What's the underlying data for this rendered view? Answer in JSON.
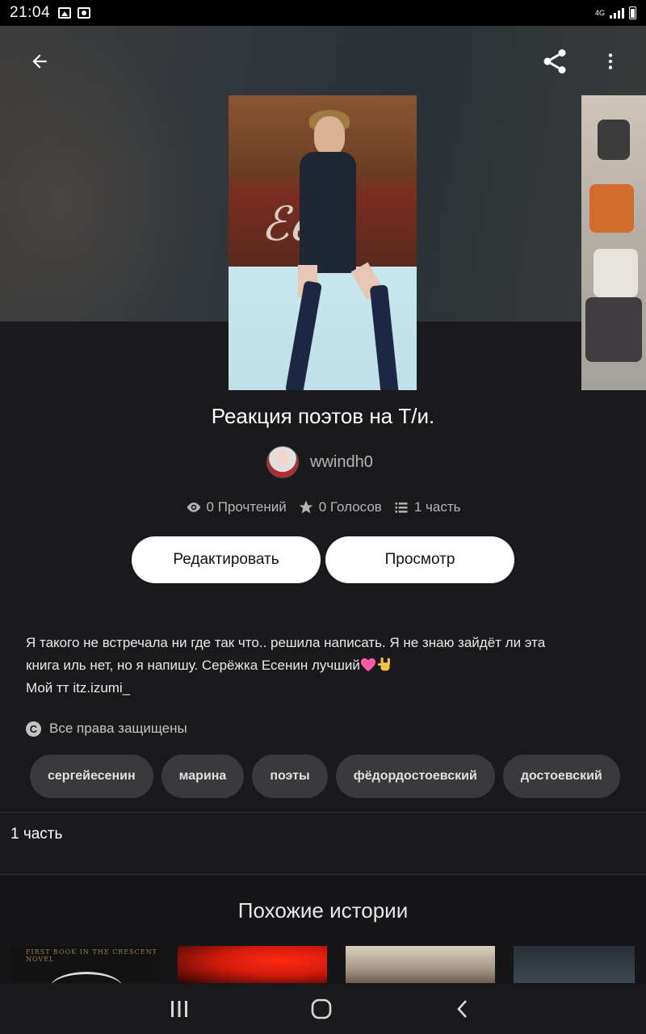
{
  "status_bar": {
    "time": "21:04",
    "network": "4G",
    "left_icons": [
      "image-icon",
      "record-icon"
    ]
  },
  "header": {
    "back_icon": "arrow-left-icon",
    "share_icon": "share-icon",
    "more_icon": "more-vertical-icon"
  },
  "story": {
    "title": "Реакция поэтов на Т/и.",
    "author": "wwindh0",
    "stats": {
      "reads": "0 Прочтений",
      "votes": "0 Голосов",
      "parts": "1 часть"
    },
    "buttons": {
      "edit": "Редактировать",
      "view": "Просмотр"
    },
    "description": {
      "line1": "Я такого не встречала ни где так что.. решила написать. Я не знаю зайдёт ли эта",
      "line2": "книга иль нет, но я напишу. Серёжка Есенин лучший",
      "line3": "Мой тт itz.izumi_"
    },
    "copyright": "Все права защищены",
    "tags": [
      "сергейесенин",
      "марина",
      "поэты",
      "фёдордостоевский",
      "достоевский"
    ],
    "parts_label": "1 часть"
  },
  "similar": {
    "title": "Похожие истории",
    "first_cover_text": "FIRST BOOK IN THE CRESCENT NOVEL"
  },
  "colors": {
    "background": "#1a191b",
    "button": "#ffffff",
    "tag": "#3a393c",
    "muted_text": "#b6b6b6"
  }
}
